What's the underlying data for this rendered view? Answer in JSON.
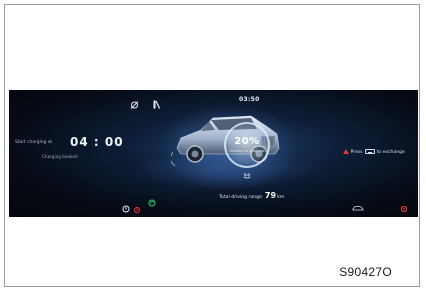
{
  "cluster": {
    "clock": "03:50",
    "charging_label": "Start charging at",
    "charging_time": "04 : 00",
    "charging_status": "Charging booked",
    "battery_percent": "20%",
    "battery_sub": "Heating in progress",
    "range_label": "Total driving range",
    "range_value": "79",
    "range_unit": "km",
    "warning_text_before": "Press",
    "warning_text_after": "to exchange"
  },
  "caption": "S90427O"
}
